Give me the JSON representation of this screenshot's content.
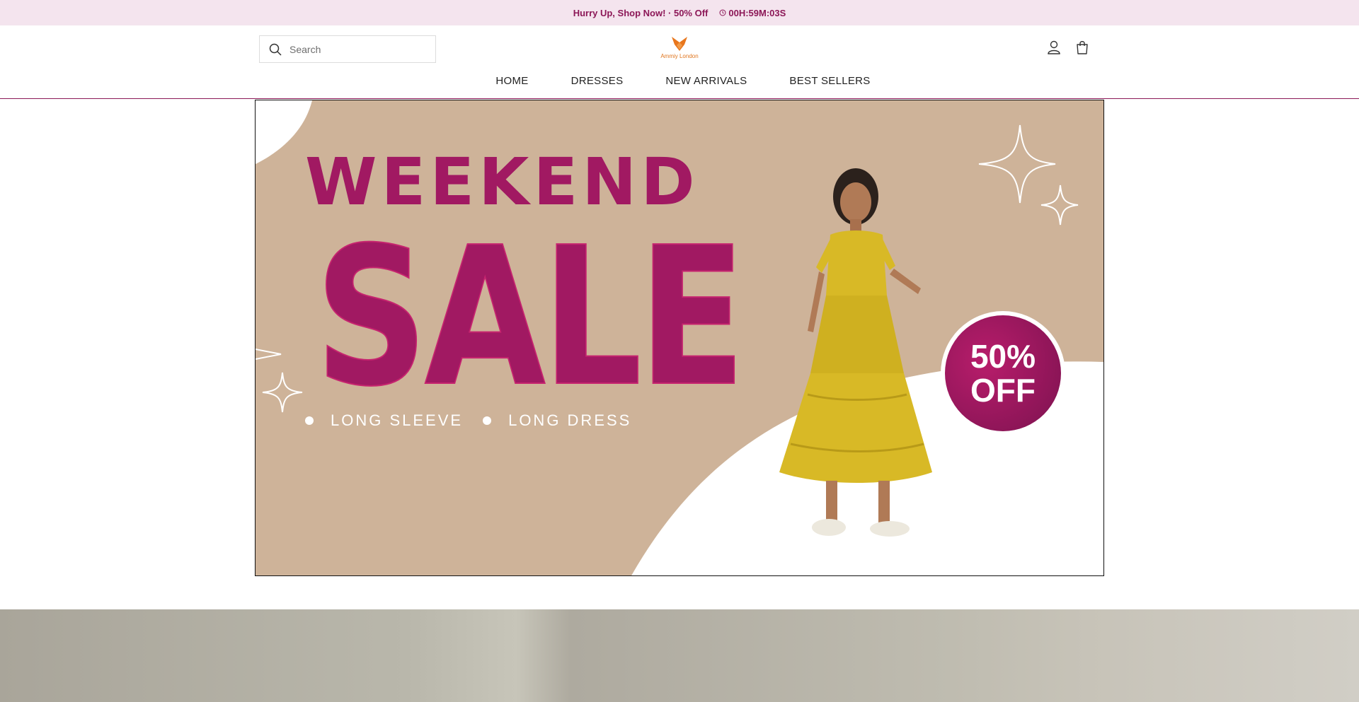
{
  "announcement": {
    "text": "Hurry Up, Shop Now! · 50% Off",
    "timer": "00H:59M:03S"
  },
  "header": {
    "search_placeholder": "Search",
    "logo_text": "Ammiy London"
  },
  "nav": {
    "items": [
      "HOME",
      "DRESSES",
      "NEW ARRIVALS",
      "BEST SELLERS"
    ]
  },
  "hero": {
    "headline_top": "WEEKEND",
    "headline_main": "SALE",
    "tags": [
      "LONG SLEEVE",
      "LONG DRESS"
    ],
    "offer_line1": "50%",
    "offer_line2": "OFF"
  },
  "colors": {
    "accent": "#8c1757",
    "banner_bg": "#ceb399",
    "announcement_bg": "#f4e4ee",
    "dress": "#d8b926"
  }
}
